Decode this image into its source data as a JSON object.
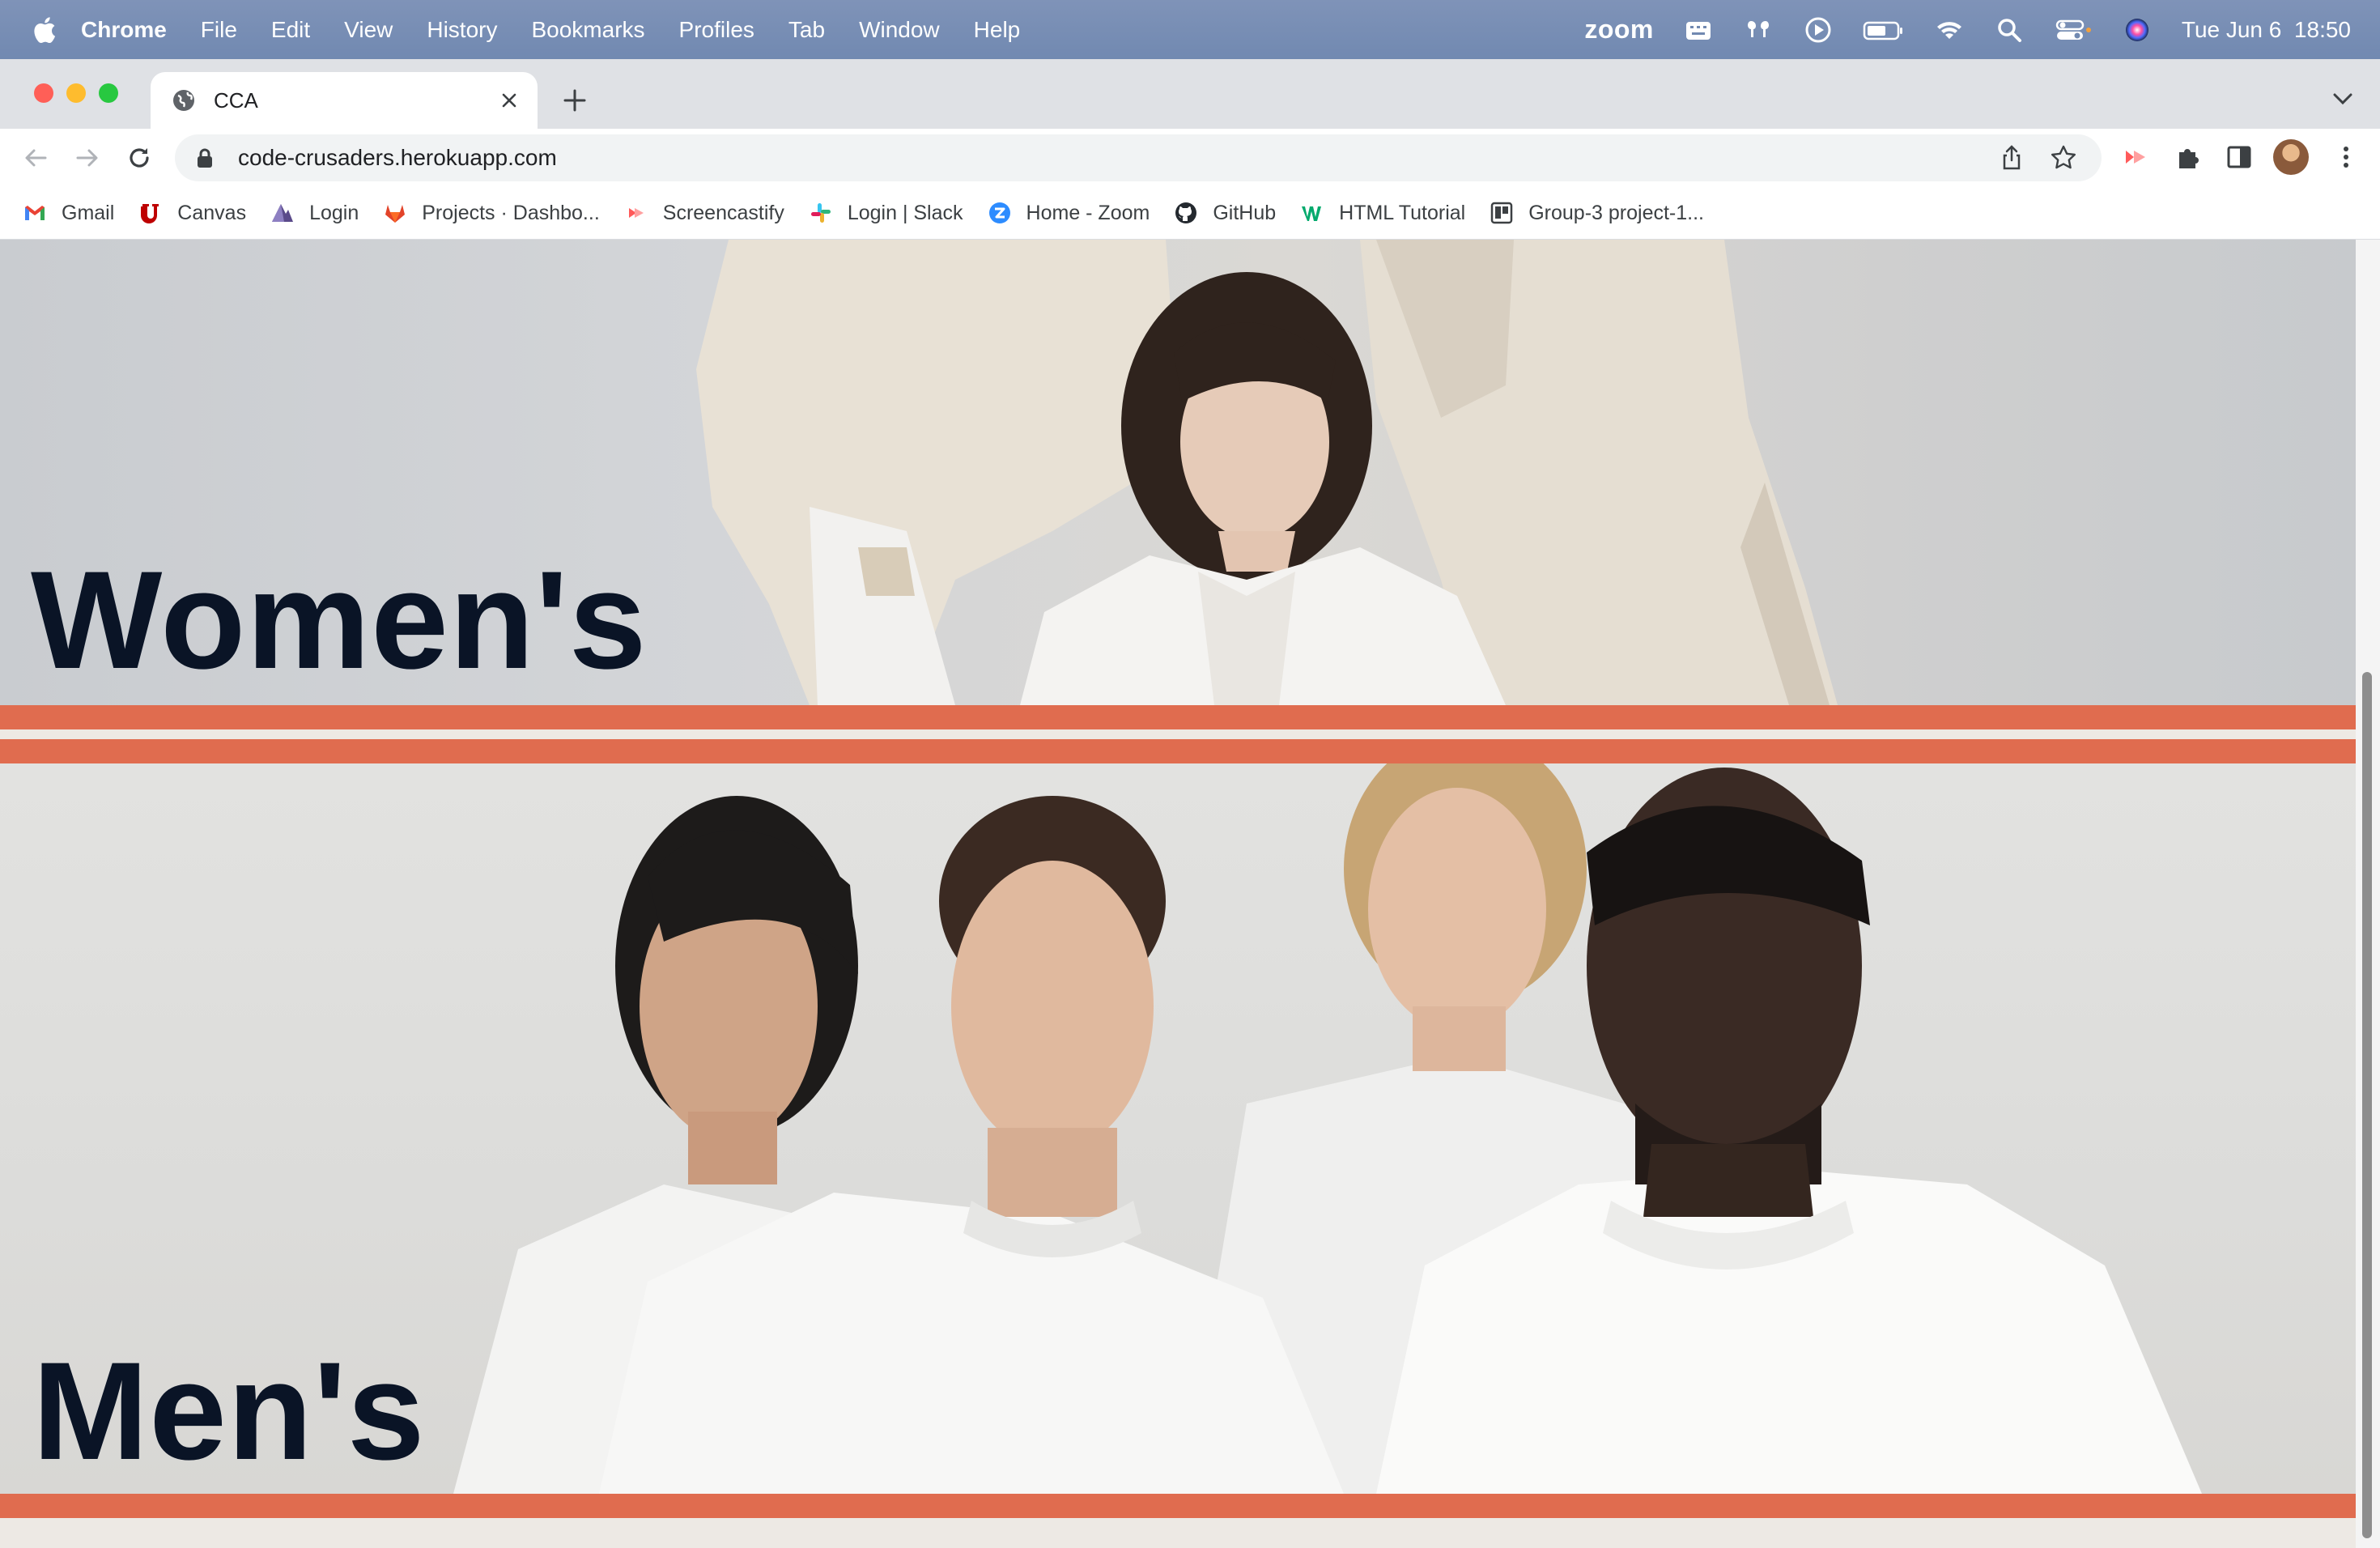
{
  "menubar": {
    "app_name": "Chrome",
    "items": [
      "File",
      "Edit",
      "View",
      "History",
      "Bookmarks",
      "Profiles",
      "Tab",
      "Window",
      "Help"
    ],
    "zoom_label": "zoom",
    "datetime": "Tue Jun 6  18:50"
  },
  "tab": {
    "title": "CCA"
  },
  "omnibox": {
    "url": "code-crusaders.herokuapp.com"
  },
  "bookmarks": [
    {
      "label": "Gmail",
      "icon": "gmail-icon",
      "color": "#ea4335"
    },
    {
      "label": "Canvas",
      "icon": "utah-u-icon",
      "color": "#be0000"
    },
    {
      "label": "Login",
      "icon": "mountain-icon",
      "color": "#5a4a8a"
    },
    {
      "label": "Projects · Dashbo...",
      "icon": "gitlab-icon",
      "color": "#e24329"
    },
    {
      "label": "Screencastify",
      "icon": "screencastify-icon",
      "color": "#ff5a5a"
    },
    {
      "label": "Login | Slack",
      "icon": "slack-icon",
      "color": "#36c5f0"
    },
    {
      "label": "Home - Zoom",
      "icon": "zoom-icon",
      "color": "#2d8cff"
    },
    {
      "label": "GitHub",
      "icon": "github-icon",
      "color": "#24292f"
    },
    {
      "label": "HTML Tutorial",
      "icon": "w3schools-icon",
      "color": "#04aa6d"
    },
    {
      "label": "Group-3 project-1...",
      "icon": "trello-icon",
      "color": "#3c4043"
    }
  ],
  "page": {
    "women_label": "Women's",
    "men_label": "Men's",
    "accent_color": "#e06c4f",
    "heading_color": "#0a1426"
  }
}
